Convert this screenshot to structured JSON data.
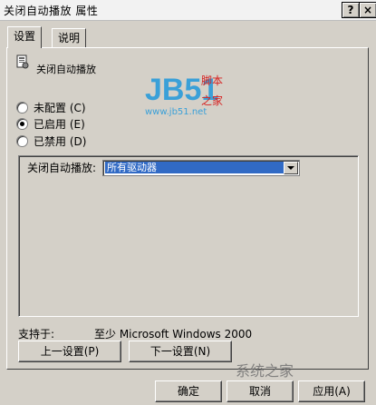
{
  "window": {
    "title": "关闭自动播放 属性",
    "help_label": "?",
    "close_label": "×"
  },
  "tabs": [
    {
      "label": "设置"
    },
    {
      "label": "说明"
    }
  ],
  "policy": {
    "name": "关闭自动播放"
  },
  "radios": [
    {
      "label": "未配置 (C)",
      "checked": false
    },
    {
      "label": "已启用 (E)",
      "checked": true
    },
    {
      "label": "已禁用 (D)",
      "checked": false
    }
  ],
  "options": {
    "combo_label": "关闭自动播放:",
    "combo_value": "所有驱动器"
  },
  "supported": {
    "label": "支持于:",
    "value": "至少 Microsoft Windows 2000"
  },
  "nav_buttons": {
    "prev": "上一设置(P)",
    "next": "下一设置(N)"
  },
  "dialog_buttons": {
    "ok": "确定",
    "cancel": "取消",
    "apply": "应用(A)"
  },
  "watermark": {
    "jb_text": "JB51",
    "jb_cn1": "脚本",
    "jb_cn2": "之家",
    "jb_url": "www.jb51.net",
    "bottom_text": "系统之家"
  },
  "colors": {
    "selection": "#316ac5",
    "jb_blue": "#3aa0d8",
    "jb_red": "#d62020"
  }
}
